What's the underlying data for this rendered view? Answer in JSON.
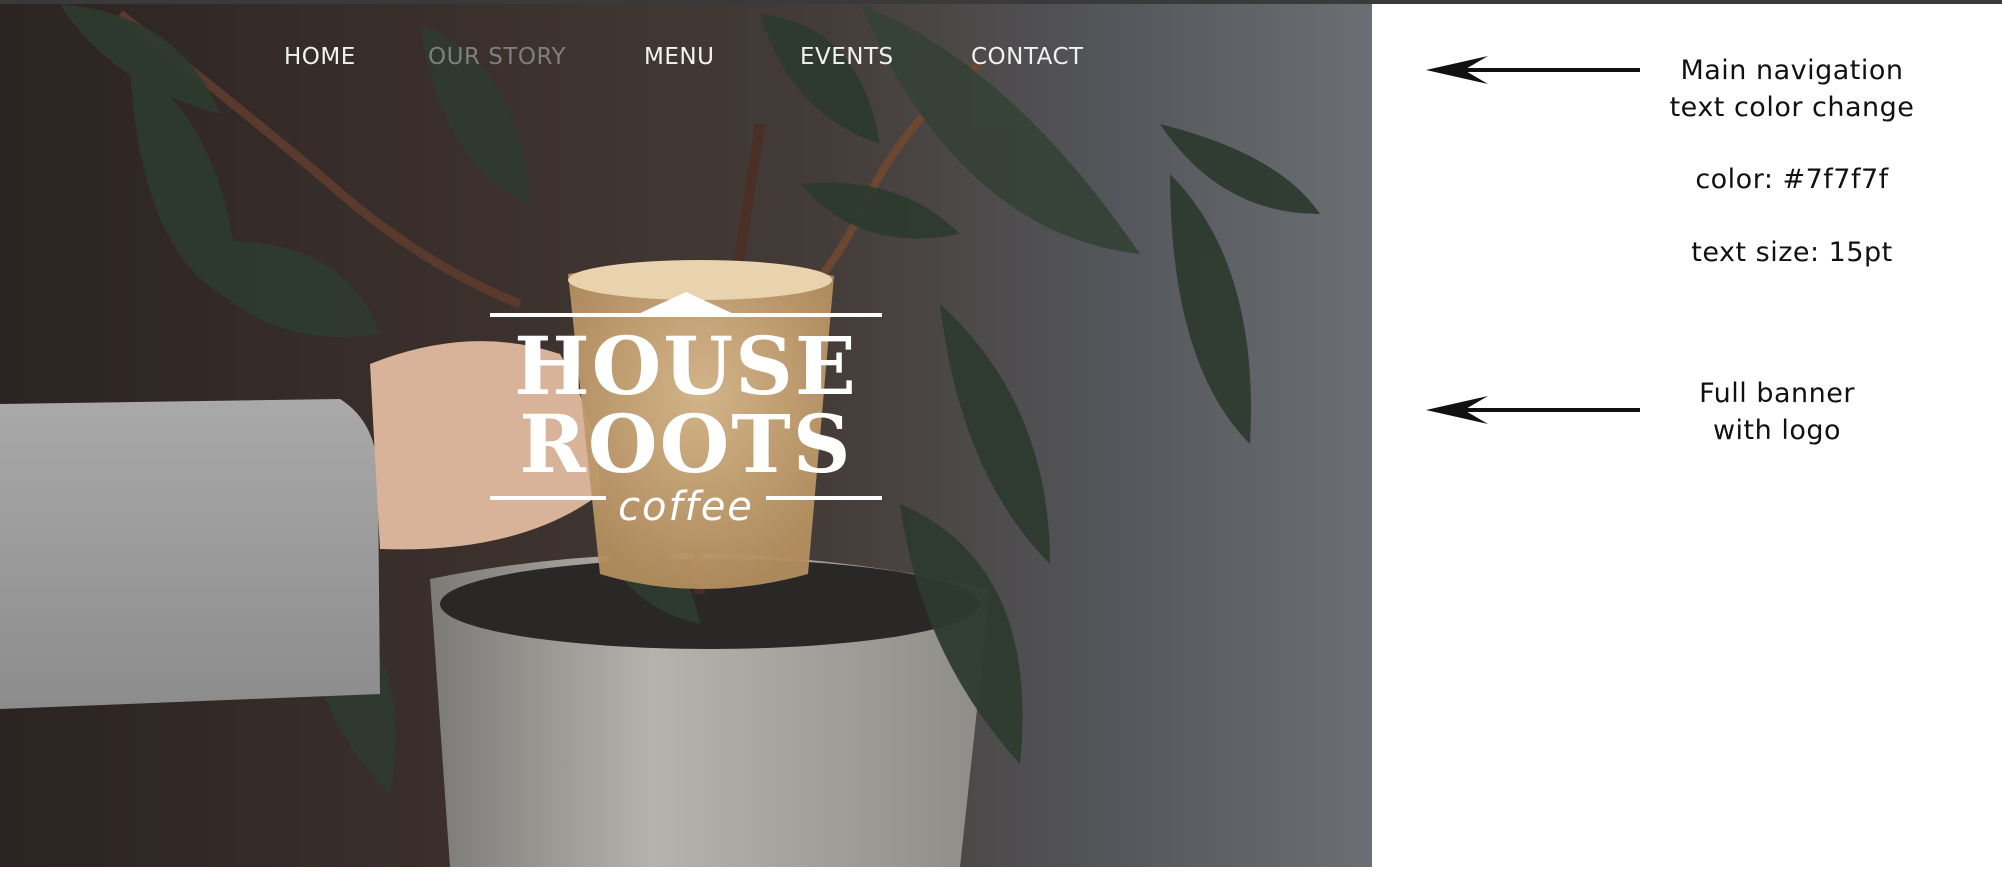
{
  "nav": {
    "items": [
      {
        "label": "HOME",
        "muted": false
      },
      {
        "label": "OUR STORY",
        "muted": true
      },
      {
        "label": "MENU",
        "muted": false
      },
      {
        "label": "EVENTS",
        "muted": false
      },
      {
        "label": "CONTACT",
        "muted": false
      }
    ],
    "text_color": "#f2f2f2",
    "muted_color": "#7f7f7f"
  },
  "logo": {
    "line1": "HOUSE",
    "line2": "ROOTS",
    "line3": "coffee",
    "color": "#ffffff"
  },
  "annotations": {
    "nav_note_line1": "Main navigation",
    "nav_note_line2": "text color change",
    "color_note": "color: #7f7f7f",
    "size_note": "text size: 15pt",
    "banner_note_line1": "Full banner",
    "banner_note_line2": "with logo"
  },
  "icons": [
    "left-arrow-icon",
    "left-arrow-icon"
  ],
  "colors": {
    "annotation_text": "#111111",
    "page_background": "#ffffff"
  }
}
